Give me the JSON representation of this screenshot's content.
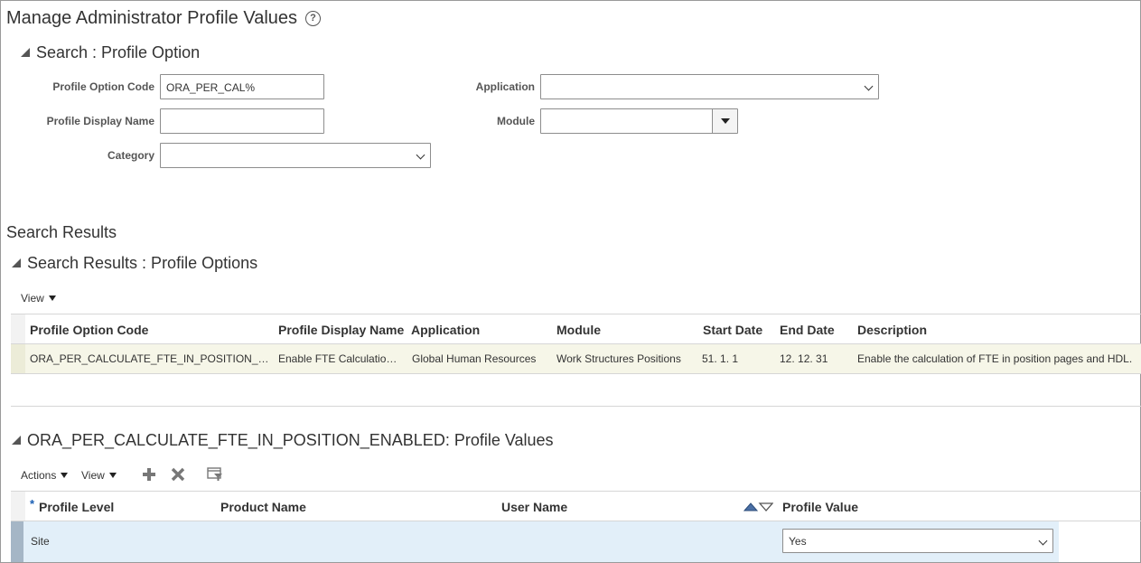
{
  "page": {
    "title": "Manage Administrator Profile Values"
  },
  "search": {
    "section_title": "Search : Profile Option",
    "profile_option_code_label": "Profile Option Code",
    "profile_option_code_value": "ORA_PER_CAL%",
    "profile_display_name_label": "Profile Display Name",
    "profile_display_name_value": "",
    "category_label": "Category",
    "category_value": "",
    "application_label": "Application",
    "application_value": "",
    "module_label": "Module",
    "module_value": ""
  },
  "results": {
    "title": "Search Results",
    "section_title": "Search Results : Profile Options",
    "view_label": "View",
    "columns": [
      "Profile Option Code",
      "Profile Display Name",
      "Application",
      "Module",
      "Start Date",
      "End Date",
      "Description"
    ],
    "rows": [
      {
        "code": "ORA_PER_CALCULATE_FTE_IN_POSITION_…",
        "display_name": "Enable FTE Calculatio…",
        "application": "Global Human Resources",
        "module": "Work Structures Positions",
        "start_date": "51. 1. 1",
        "end_date": "12. 12. 31",
        "description": "Enable the calculation of FTE in position pages and HDL."
      }
    ]
  },
  "values": {
    "section_title": "ORA_PER_CALCULATE_FTE_IN_POSITION_ENABLED: Profile Values",
    "actions_label": "Actions",
    "view_label": "View",
    "required_marker": "*",
    "columns": [
      "Profile Level",
      "Product Name",
      "User Name",
      "Profile Value"
    ],
    "rows": [
      {
        "profile_level": "Site",
        "product_name": "",
        "user_name": "",
        "profile_value": "Yes"
      }
    ],
    "icons": [
      "add-icon",
      "delete-icon",
      "query-by-example-icon"
    ],
    "help_glyph": "?"
  }
}
